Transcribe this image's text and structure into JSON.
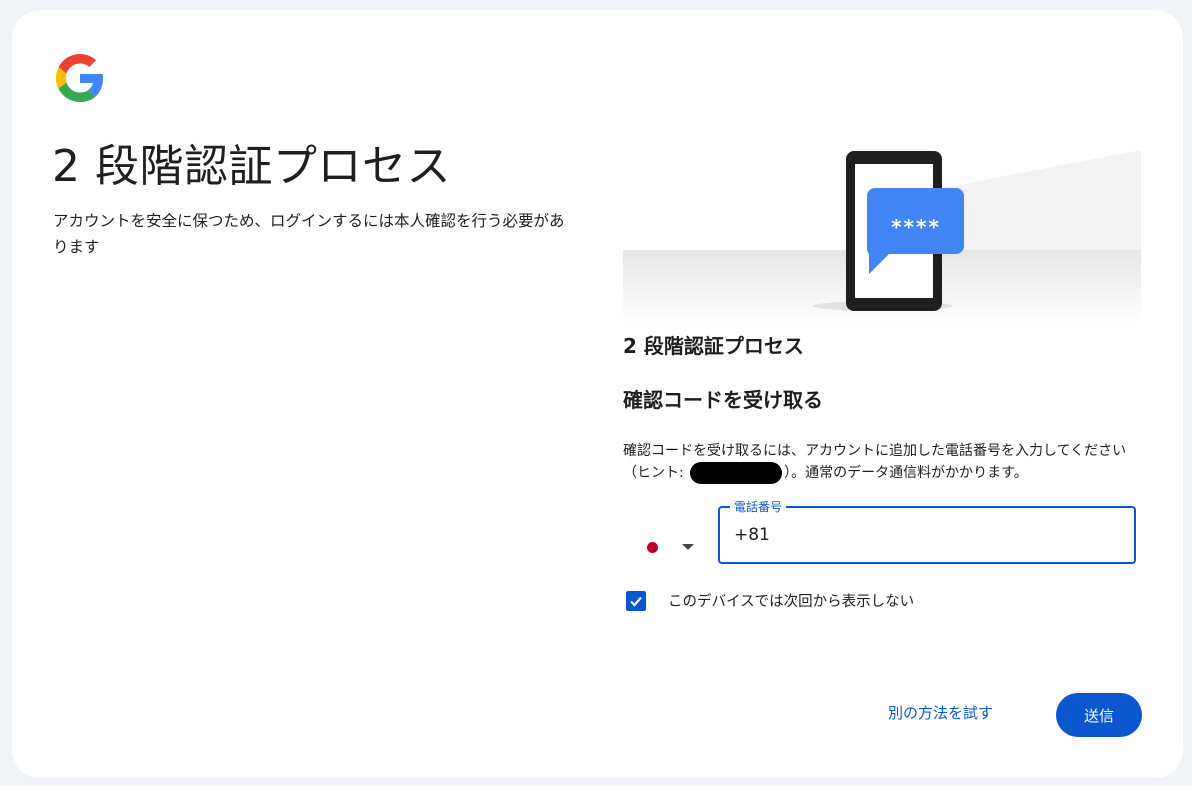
{
  "brand": {
    "logo_icon": "google-g-logo-icon"
  },
  "header": {
    "title": "2 段階認証プロセス",
    "subtitle": "アカウントを安全に保つため、ログインするには本人確認を行う必要があります"
  },
  "illustration": {
    "icon": "phone-sms-code-icon",
    "code_mask": "****"
  },
  "panel": {
    "section_title": "2 段階認証プロセス",
    "step_title": "確認コードを受け取る",
    "description_before_hint": "確認コードを受け取るには、アカウントに追加した電話番号を入力してください（ヒント: ",
    "description_after_hint": "）。通常のデータ通信料がかかります。",
    "country_select": {
      "flag": "japan-flag-icon",
      "arrow": "dropdown-arrow-icon"
    },
    "phone_field": {
      "label": "電話番号",
      "value": "+81"
    },
    "remember_device": {
      "label": "このデバイスでは次回から表示しない",
      "checked": true
    }
  },
  "actions": {
    "try_another": "別の方法を試す",
    "submit": "送信"
  },
  "colors": {
    "accent": "#0b57d0",
    "background": "#f0f4f9",
    "card": "#ffffff"
  }
}
